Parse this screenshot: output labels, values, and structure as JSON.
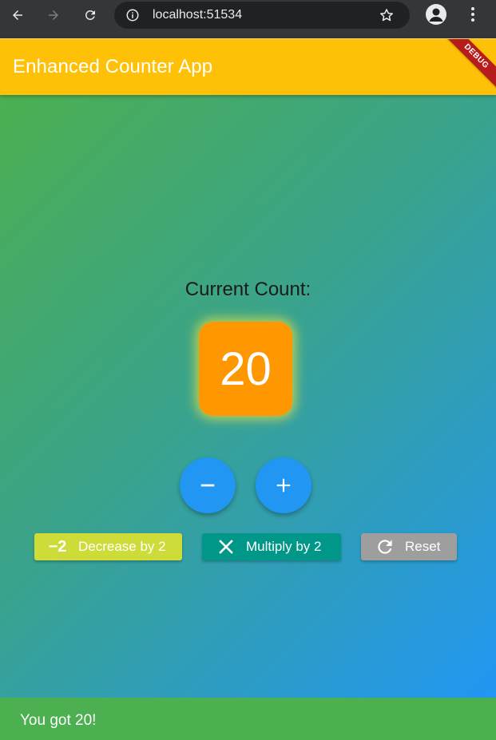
{
  "browser": {
    "url": "localhost:51534",
    "icons": [
      "back-arrow-icon",
      "forward-arrow-icon",
      "reload-icon",
      "info-icon",
      "star-icon",
      "profile-icon",
      "more-vert-icon"
    ]
  },
  "app_bar": {
    "title": "Enhanced Counter App",
    "debug_label": "DEBUG",
    "color": "#ffc107"
  },
  "counter": {
    "label": "Current Count:",
    "value": "20",
    "box_color": "#ff9800"
  },
  "fabs": {
    "decrement_icon": "minus-icon",
    "increment_icon": "plus-icon",
    "color": "#2196f3"
  },
  "actions": {
    "decrease": {
      "icon_text": "−2",
      "label": "Decrease by 2",
      "color": "#cddc39"
    },
    "multiply": {
      "icon": "close-x-icon",
      "label": "Multiply by 2",
      "color": "#009688"
    },
    "reset": {
      "icon": "refresh-icon",
      "label": "Reset",
      "color": "#9e9e9e"
    }
  },
  "snackbar": {
    "message": "You got 20!",
    "color": "#4caf50"
  },
  "background_gradient": [
    "#4caf50",
    "#2196f3"
  ]
}
